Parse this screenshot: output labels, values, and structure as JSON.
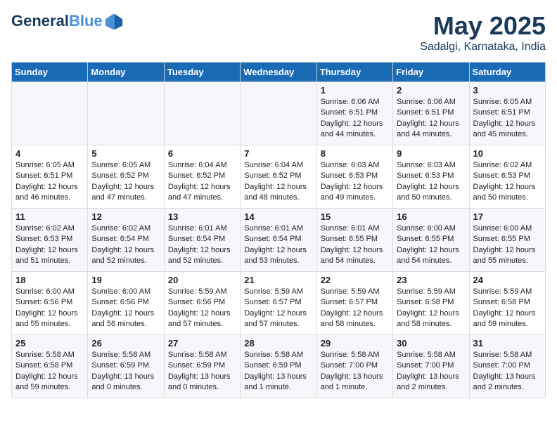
{
  "header": {
    "logo_text_general": "General",
    "logo_text_blue": "Blue",
    "month_title": "May 2025",
    "location": "Sadalgi, Karnataka, India"
  },
  "weekdays": [
    "Sunday",
    "Monday",
    "Tuesday",
    "Wednesday",
    "Thursday",
    "Friday",
    "Saturday"
  ],
  "weeks": [
    [
      {
        "day": "",
        "info": ""
      },
      {
        "day": "",
        "info": ""
      },
      {
        "day": "",
        "info": ""
      },
      {
        "day": "",
        "info": ""
      },
      {
        "day": "1",
        "info": "Sunrise: 6:06 AM\nSunset: 6:51 PM\nDaylight: 12 hours\nand 44 minutes."
      },
      {
        "day": "2",
        "info": "Sunrise: 6:06 AM\nSunset: 6:51 PM\nDaylight: 12 hours\nand 44 minutes."
      },
      {
        "day": "3",
        "info": "Sunrise: 6:05 AM\nSunset: 6:51 PM\nDaylight: 12 hours\nand 45 minutes."
      }
    ],
    [
      {
        "day": "4",
        "info": "Sunrise: 6:05 AM\nSunset: 6:51 PM\nDaylight: 12 hours\nand 46 minutes."
      },
      {
        "day": "5",
        "info": "Sunrise: 6:05 AM\nSunset: 6:52 PM\nDaylight: 12 hours\nand 47 minutes."
      },
      {
        "day": "6",
        "info": "Sunrise: 6:04 AM\nSunset: 6:52 PM\nDaylight: 12 hours\nand 47 minutes."
      },
      {
        "day": "7",
        "info": "Sunrise: 6:04 AM\nSunset: 6:52 PM\nDaylight: 12 hours\nand 48 minutes."
      },
      {
        "day": "8",
        "info": "Sunrise: 6:03 AM\nSunset: 6:53 PM\nDaylight: 12 hours\nand 49 minutes."
      },
      {
        "day": "9",
        "info": "Sunrise: 6:03 AM\nSunset: 6:53 PM\nDaylight: 12 hours\nand 50 minutes."
      },
      {
        "day": "10",
        "info": "Sunrise: 6:02 AM\nSunset: 6:53 PM\nDaylight: 12 hours\nand 50 minutes."
      }
    ],
    [
      {
        "day": "11",
        "info": "Sunrise: 6:02 AM\nSunset: 6:53 PM\nDaylight: 12 hours\nand 51 minutes."
      },
      {
        "day": "12",
        "info": "Sunrise: 6:02 AM\nSunset: 6:54 PM\nDaylight: 12 hours\nand 52 minutes."
      },
      {
        "day": "13",
        "info": "Sunrise: 6:01 AM\nSunset: 6:54 PM\nDaylight: 12 hours\nand 52 minutes."
      },
      {
        "day": "14",
        "info": "Sunrise: 6:01 AM\nSunset: 6:54 PM\nDaylight: 12 hours\nand 53 minutes."
      },
      {
        "day": "15",
        "info": "Sunrise: 6:01 AM\nSunset: 6:55 PM\nDaylight: 12 hours\nand 54 minutes."
      },
      {
        "day": "16",
        "info": "Sunrise: 6:00 AM\nSunset: 6:55 PM\nDaylight: 12 hours\nand 54 minutes."
      },
      {
        "day": "17",
        "info": "Sunrise: 6:00 AM\nSunset: 6:55 PM\nDaylight: 12 hours\nand 55 minutes."
      }
    ],
    [
      {
        "day": "18",
        "info": "Sunrise: 6:00 AM\nSunset: 6:56 PM\nDaylight: 12 hours\nand 55 minutes."
      },
      {
        "day": "19",
        "info": "Sunrise: 6:00 AM\nSunset: 6:56 PM\nDaylight: 12 hours\nand 56 minutes."
      },
      {
        "day": "20",
        "info": "Sunrise: 5:59 AM\nSunset: 6:56 PM\nDaylight: 12 hours\nand 57 minutes."
      },
      {
        "day": "21",
        "info": "Sunrise: 5:59 AM\nSunset: 6:57 PM\nDaylight: 12 hours\nand 57 minutes."
      },
      {
        "day": "22",
        "info": "Sunrise: 5:59 AM\nSunset: 6:57 PM\nDaylight: 12 hours\nand 58 minutes."
      },
      {
        "day": "23",
        "info": "Sunrise: 5:59 AM\nSunset: 6:58 PM\nDaylight: 12 hours\nand 58 minutes."
      },
      {
        "day": "24",
        "info": "Sunrise: 5:59 AM\nSunset: 6:58 PM\nDaylight: 12 hours\nand 59 minutes."
      }
    ],
    [
      {
        "day": "25",
        "info": "Sunrise: 5:58 AM\nSunset: 6:58 PM\nDaylight: 12 hours\nand 59 minutes."
      },
      {
        "day": "26",
        "info": "Sunrise: 5:58 AM\nSunset: 6:59 PM\nDaylight: 13 hours\nand 0 minutes."
      },
      {
        "day": "27",
        "info": "Sunrise: 5:58 AM\nSunset: 6:59 PM\nDaylight: 13 hours\nand 0 minutes."
      },
      {
        "day": "28",
        "info": "Sunrise: 5:58 AM\nSunset: 6:59 PM\nDaylight: 13 hours\nand 1 minute."
      },
      {
        "day": "29",
        "info": "Sunrise: 5:58 AM\nSunset: 7:00 PM\nDaylight: 13 hours\nand 1 minute."
      },
      {
        "day": "30",
        "info": "Sunrise: 5:58 AM\nSunset: 7:00 PM\nDaylight: 13 hours\nand 2 minutes."
      },
      {
        "day": "31",
        "info": "Sunrise: 5:58 AM\nSunset: 7:00 PM\nDaylight: 13 hours\nand 2 minutes."
      }
    ]
  ]
}
